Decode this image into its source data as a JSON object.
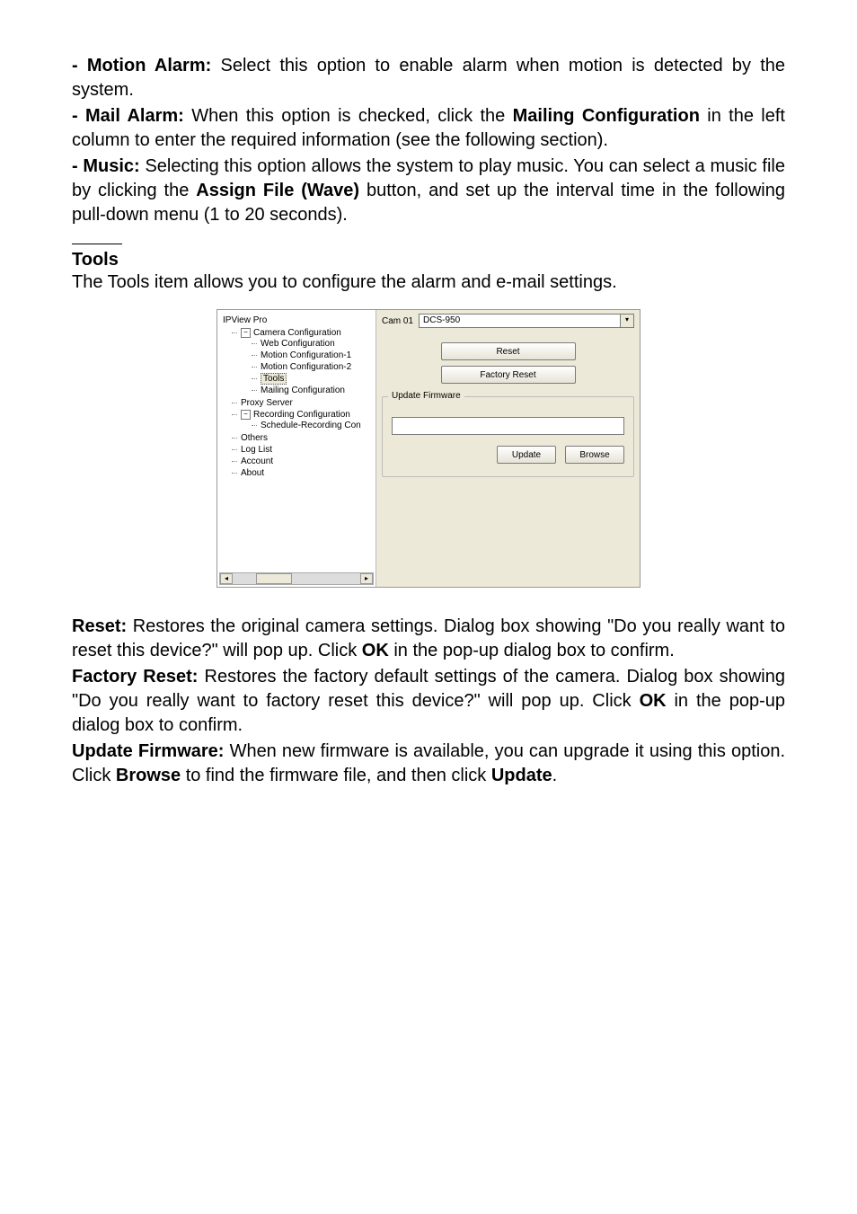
{
  "top_text": {
    "motion_label": "- Motion Alarm: ",
    "motion_body": "Select this option to enable alarm when motion is detected by the system.",
    "mail_label": "- Mail Alarm: ",
    "mail_body_1": "When this option is checked, click the ",
    "mail_link": "Mailing Configuration",
    "mail_body_2": " in the left column to enter the required information (see the following section).",
    "music_label": "- Music: ",
    "music_body_1": "Selecting this option allows the system to play music.  You can select a music file by clicking the ",
    "music_btn": "Assign File (Wave)",
    "music_body_2": " button, and set up the interval time in the following pull-down menu (1 to 20 seconds)."
  },
  "tools": {
    "heading": "Tools ",
    "sentence_1": "The ",
    "sentence_bold": "Tools",
    "sentence_2": " item allows you to configure the alarm and e-mail settings."
  },
  "screenshot": {
    "root": "IPView Pro",
    "cam_label": "Cam 01",
    "cam_value": "DCS-950",
    "reset": "Reset",
    "factory_reset": "Factory Reset",
    "group_title": "Update Firmware",
    "update": "Update",
    "browse": "Browse",
    "tree": {
      "l0": "Camera Configuration",
      "l1": "Web Configuration",
      "l2": "Motion Configuration-1",
      "l3": "Motion Configuration-2",
      "l4": "Tools",
      "l5": "Mailing Configuration",
      "l6": "Proxy Server",
      "l7": "Recording Configuration",
      "l8": "Schedule-Recording Con",
      "l9": "Others",
      "l10": "Log List",
      "l11": "Account",
      "l12": "About"
    }
  },
  "bottom_text": {
    "reset_label": "Reset: ",
    "reset_body_1": "Restores the original camera settings. Dialog box showing \"Do you really want to reset this device?\" will pop up.  Click ",
    "reset_action": "OK",
    "reset_body_2": " in the pop-up dialog box to confirm.",
    "fr_label": "Factory Reset: ",
    "fr_body_1": "Restores the factory default settings of the camera.  Dialog box showing \"Do you really want to factory reset this device?\" will pop up.  Click ",
    "fr_action": "OK",
    "fr_body_2": " in the pop-up dialog box to confirm.",
    "uf_label": "Update Firmware: ",
    "uf_body_1": "When new firmware is available, you can upgrade it using this option.  Click ",
    "uf_browse": "Browse",
    "uf_body_2": " to find the firmware file, and then click ",
    "uf_update": "Update",
    "uf_body_3": "."
  }
}
